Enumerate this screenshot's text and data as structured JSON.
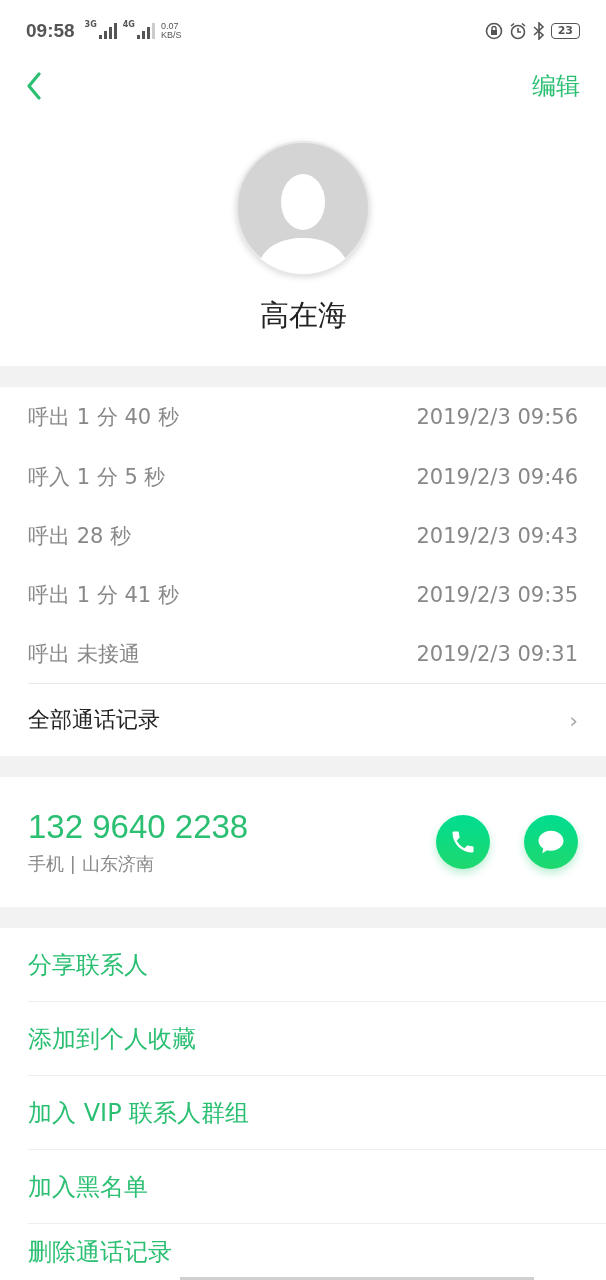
{
  "status_bar": {
    "time": "09:58",
    "network_1": "3G",
    "network_2": "4G",
    "speed": "0.07",
    "speed_unit": "KB/S",
    "battery": "23"
  },
  "header": {
    "edit": "编辑"
  },
  "contact": {
    "name": "高在海"
  },
  "call_log": [
    {
      "summary": "呼出  1 分 40 秒",
      "time": "2019/2/3 09:56"
    },
    {
      "summary": "呼入  1 分 5 秒",
      "time": "2019/2/3 09:46"
    },
    {
      "summary": "呼出  28 秒",
      "time": "2019/2/3 09:43"
    },
    {
      "summary": "呼出  1 分 41 秒",
      "time": "2019/2/3 09:35"
    },
    {
      "summary": "呼出 未接通",
      "time": "2019/2/3 09:31"
    }
  ],
  "all_calls": {
    "label": "全部通话记录",
    "chevron": "›"
  },
  "phone": {
    "number": "132 9640 2238",
    "label": "手机 | 山东济南"
  },
  "actions": [
    "分享联系人",
    "添加到个人收藏",
    "加入 VIP 联系人群组",
    "加入黑名单",
    "删除通话记录"
  ]
}
